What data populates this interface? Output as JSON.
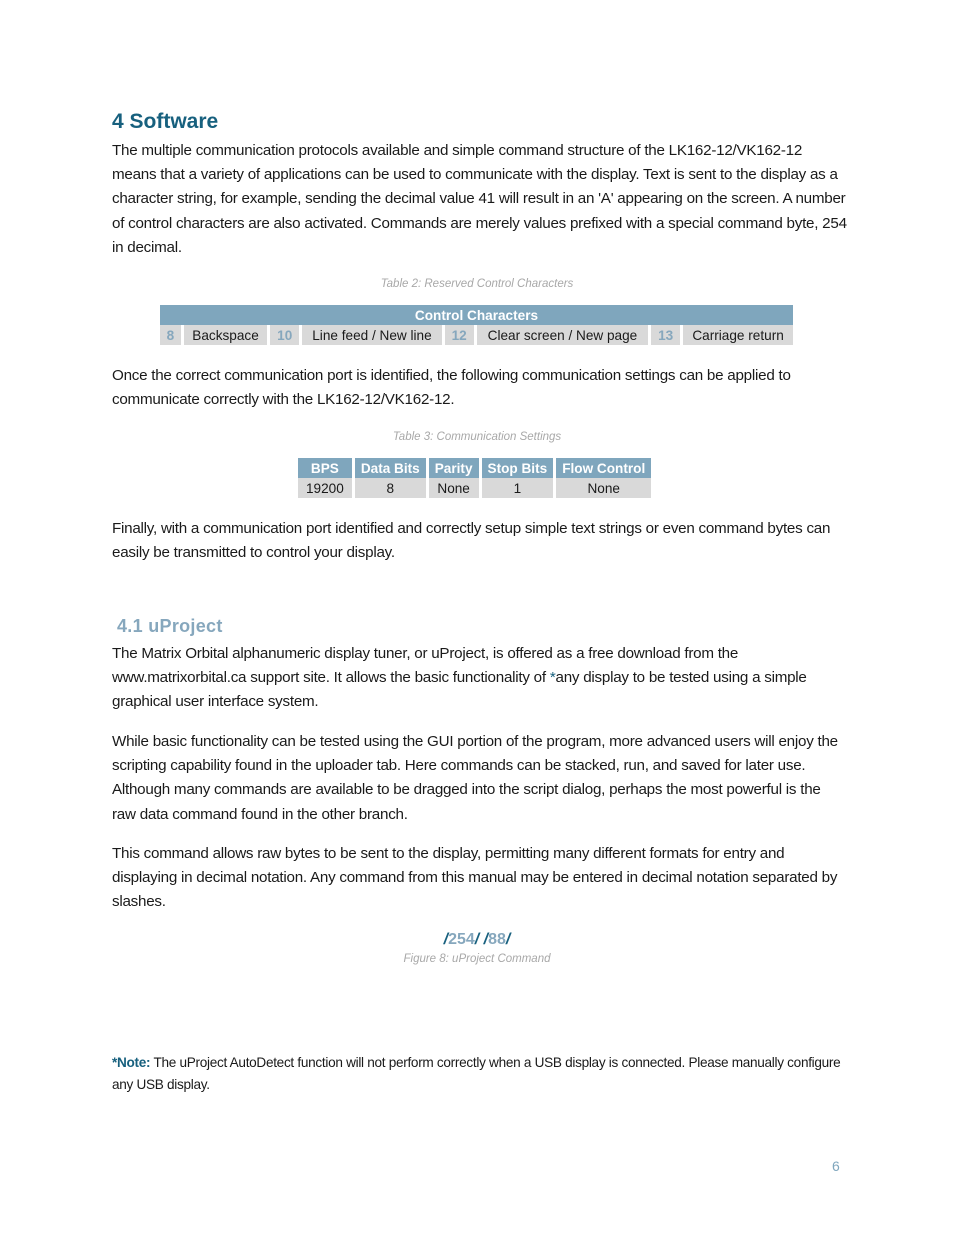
{
  "section": {
    "title": "4 Software",
    "intro": "The multiple communication protocols available and simple command structure of the LK162-12/VK162-12 means that a variety of applications can be used to communicate with the display.  Text is sent to the display as a character string, for example, sending the decimal value 41 will result in an 'A' appearing on the screen.  A number of control characters are also activated.  Commands are merely values prefixed with a special command byte, 254 in decimal."
  },
  "table2": {
    "caption": "Table 2: Reserved Control Characters",
    "header": "Control Characters",
    "items": [
      {
        "code": "8",
        "label": "Backspace"
      },
      {
        "code": "10",
        "label": "Line feed / New line"
      },
      {
        "code": "12",
        "label": "Clear screen / New page"
      },
      {
        "code": "13",
        "label": "Carriage return"
      }
    ]
  },
  "para_after_table2": "Once the correct communication port is identified, the following communication settings can be applied to communicate correctly with the LK162-12/VK162-12.",
  "table3": {
    "caption": "Table 3: Communication Settings",
    "headers": [
      "BPS",
      "Data Bits",
      "Parity",
      "Stop Bits",
      "Flow Control"
    ],
    "row": [
      "19200",
      "8",
      "None",
      "1",
      "None"
    ]
  },
  "para_after_table3": "Finally, with a communication port identified and correctly setup simple text strings or even command bytes can easily be transmitted to control your display.",
  "subsection": {
    "title": "4.1 uProject",
    "p1_before": "The Matrix Orbital alphanumeric display tuner, or uProject, is offered as a free download from the www.matrixorbital.ca support site.  It allows the basic functionality of ",
    "p1_asterisk": "*",
    "p1_after": "any display to be tested using a simple graphical user interface system.",
    "p2": "While basic functionality can be tested using the GUI portion of the program, more advanced users will enjoy the scripting capability found in the uploader tab.  Here commands can be stacked, run, and saved for later use.  Although many commands are available to be dragged into the script dialog, perhaps the most powerful is the raw data command found in the other branch.",
    "p3": "This command allows raw bytes to be sent to the display, permitting many different formats for entry and displaying in decimal notation.  Any command from this manual may be entered in decimal notation separated by slashes."
  },
  "figure8": {
    "command": {
      "slash": "/",
      "values": [
        "254",
        "88"
      ]
    },
    "caption": "Figure 8: uProject Command"
  },
  "note": {
    "label": "*Note:",
    "text": " The uProject AutoDetect function will not perform correctly when a USB display is connected.  Please manually configure any USB display."
  },
  "page_number": "6"
}
